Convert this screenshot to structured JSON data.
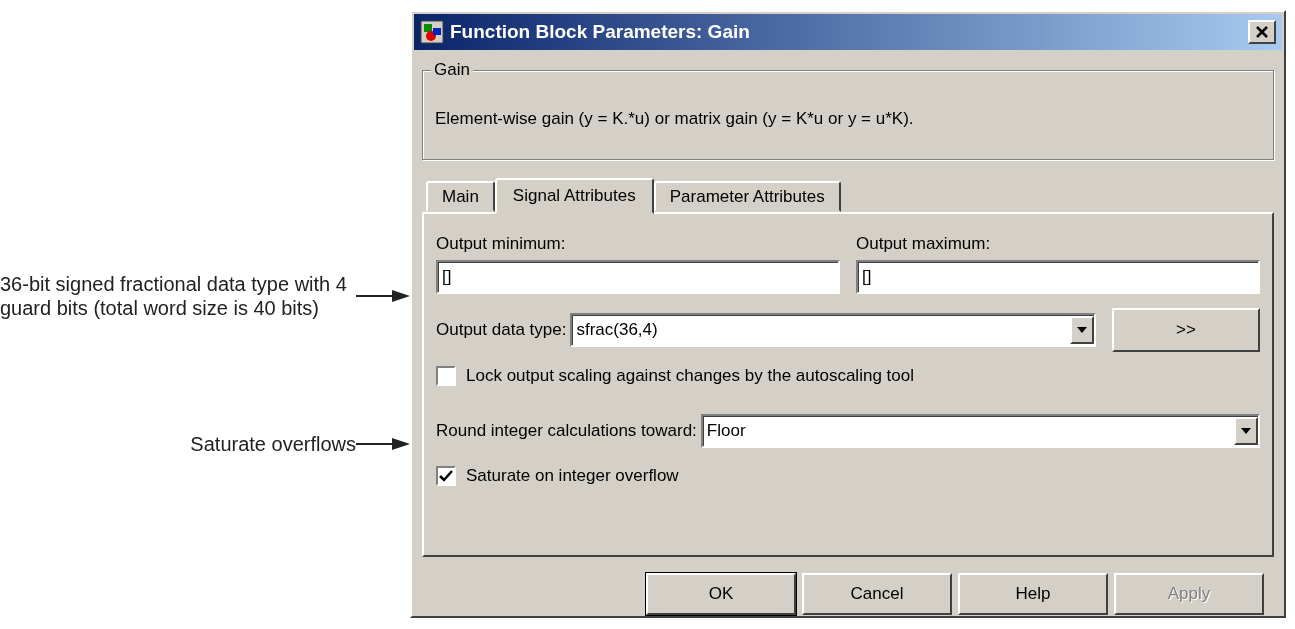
{
  "annotations": [
    {
      "text": "36-bit signed fractional data type with 4 guard bits (total word size is 40 bits)"
    },
    {
      "text": "Saturate overflows"
    }
  ],
  "dialog": {
    "title": "Function Block Parameters: Gain",
    "group": {
      "label": "Gain",
      "description": "Element-wise gain (y = K.*u) or matrix gain (y = K*u or y = u*K)."
    },
    "tabs": [
      {
        "label": "Main",
        "selected": false
      },
      {
        "label": "Signal Attributes",
        "selected": true
      },
      {
        "label": "Parameter Attributes",
        "selected": false
      }
    ],
    "output_minimum": {
      "label": "Output minimum:",
      "value": "[]"
    },
    "output_maximum": {
      "label": "Output maximum:",
      "value": "[]"
    },
    "output_data_type": {
      "label": "Output data type:",
      "value": "sfrac(36,4)",
      "button": ">>"
    },
    "lock_scaling": {
      "label": "Lock output scaling against changes by the autoscaling tool",
      "checked": false
    },
    "round": {
      "label": "Round integer calculations toward:",
      "value": "Floor"
    },
    "saturate": {
      "label": "Saturate on integer overflow",
      "checked": true
    },
    "buttons": [
      {
        "label": "OK",
        "default": true,
        "disabled": false
      },
      {
        "label": "Cancel",
        "default": false,
        "disabled": false
      },
      {
        "label": "Help",
        "default": false,
        "disabled": false
      },
      {
        "label": "Apply",
        "default": false,
        "disabled": true
      }
    ]
  }
}
